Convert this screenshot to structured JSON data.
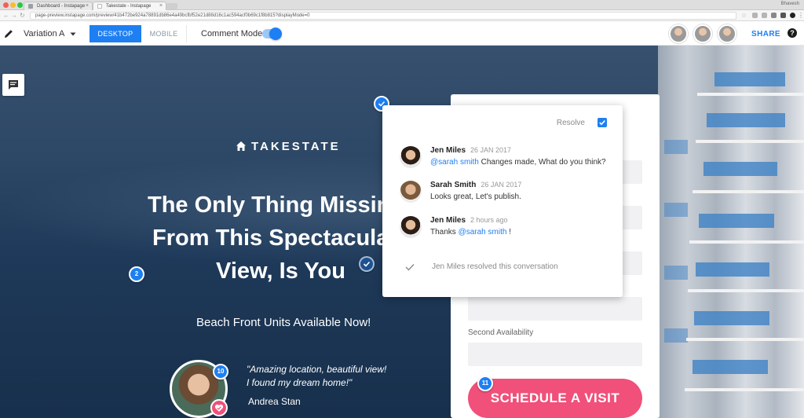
{
  "browser": {
    "tabs": [
      {
        "title": "Dashboard - Instapage"
      },
      {
        "title": "Takestate - Instapage"
      }
    ],
    "user": "Bhavesh",
    "url": "page-preview.instapage.com/preview/41b472be924a78891db86e4a49bcfbf52e21d88d16c1ac594acf0b69c1f8b815?displayMode=0"
  },
  "toolbar": {
    "variation": "Variation A",
    "desktop": "DESKTOP",
    "mobile": "MOBILE",
    "comment_mode": "Comment Mode",
    "share": "SHARE",
    "help": "?"
  },
  "page": {
    "brand": "TAKESTATE",
    "headline": [
      "The Only Thing Missing",
      "From This Spectacular",
      "View, Is You"
    ],
    "subline": "Beach Front Units Available Now!",
    "quote": [
      "\"Amazing location, beautiful view!",
      "I found my dream home!\""
    ],
    "author": "Andrea Stan",
    "form": {
      "second_availability": "Second Availability",
      "cta": "SCHEDULE A VISIT"
    }
  },
  "pins": {
    "p2": "2",
    "p10": "10",
    "p11": "11"
  },
  "comment_thread": {
    "resolve_label": "Resolve",
    "comments": [
      {
        "name": "Jen Miles",
        "date": "26 JAN 2017",
        "mention": "@sarah  smith",
        "text": " Changes made, What do you think?"
      },
      {
        "name": "Sarah Smith",
        "date": "26 JAN 2017",
        "mention": "",
        "text": "Looks great, Let's publish."
      },
      {
        "name": "Jen Miles",
        "date": "2 hours ago",
        "mention": "@sarah  smith",
        "text": " !",
        "prefix": "Thanks "
      }
    ],
    "resolved_note": "Jen Miles resolved this conversation"
  },
  "colors": {
    "accent": "#1e7ff3",
    "cta": "#f0507a"
  }
}
